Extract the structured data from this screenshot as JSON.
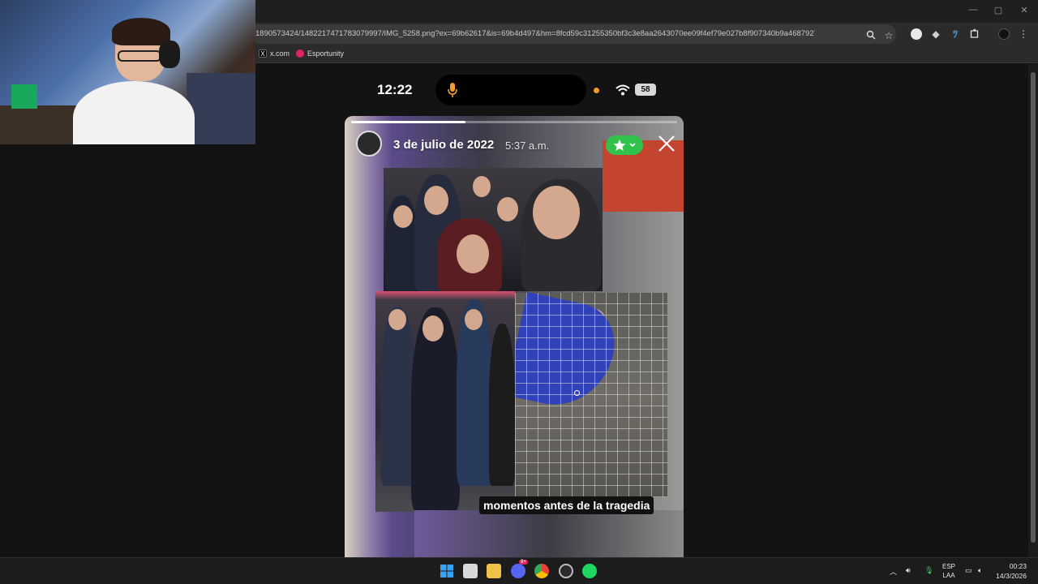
{
  "browser": {
    "url": "1890573424/1482217471783079997/IMG_5258.png?ex=69b62617&is=69b4d497&hm=8fcd59c31255350bf3c3e8aa2643070ee09f4ef79e027b8f907340b9a4687927&",
    "bookmarks": [
      {
        "label": "x.com",
        "icon": "x-logo-icon"
      },
      {
        "label": "Esportunity",
        "icon": "esportunity-icon"
      }
    ],
    "window_controls": [
      "—",
      "▢",
      "✕"
    ]
  },
  "phone_status": {
    "time": "12:22",
    "battery": "58"
  },
  "story": {
    "date": "3 de julio de 2022",
    "time": "5:37 a.m.",
    "caption": "momentos antes de la tragedia",
    "progress": 0.35
  },
  "taskbar": {
    "discord_badge": "9+",
    "language": "ESP",
    "layout": "LAA",
    "clock_time": "00:23",
    "clock_date": "14/3/2026"
  },
  "colors": {
    "close_friends": "#30c24a",
    "record_dot": "#f29a2e"
  }
}
